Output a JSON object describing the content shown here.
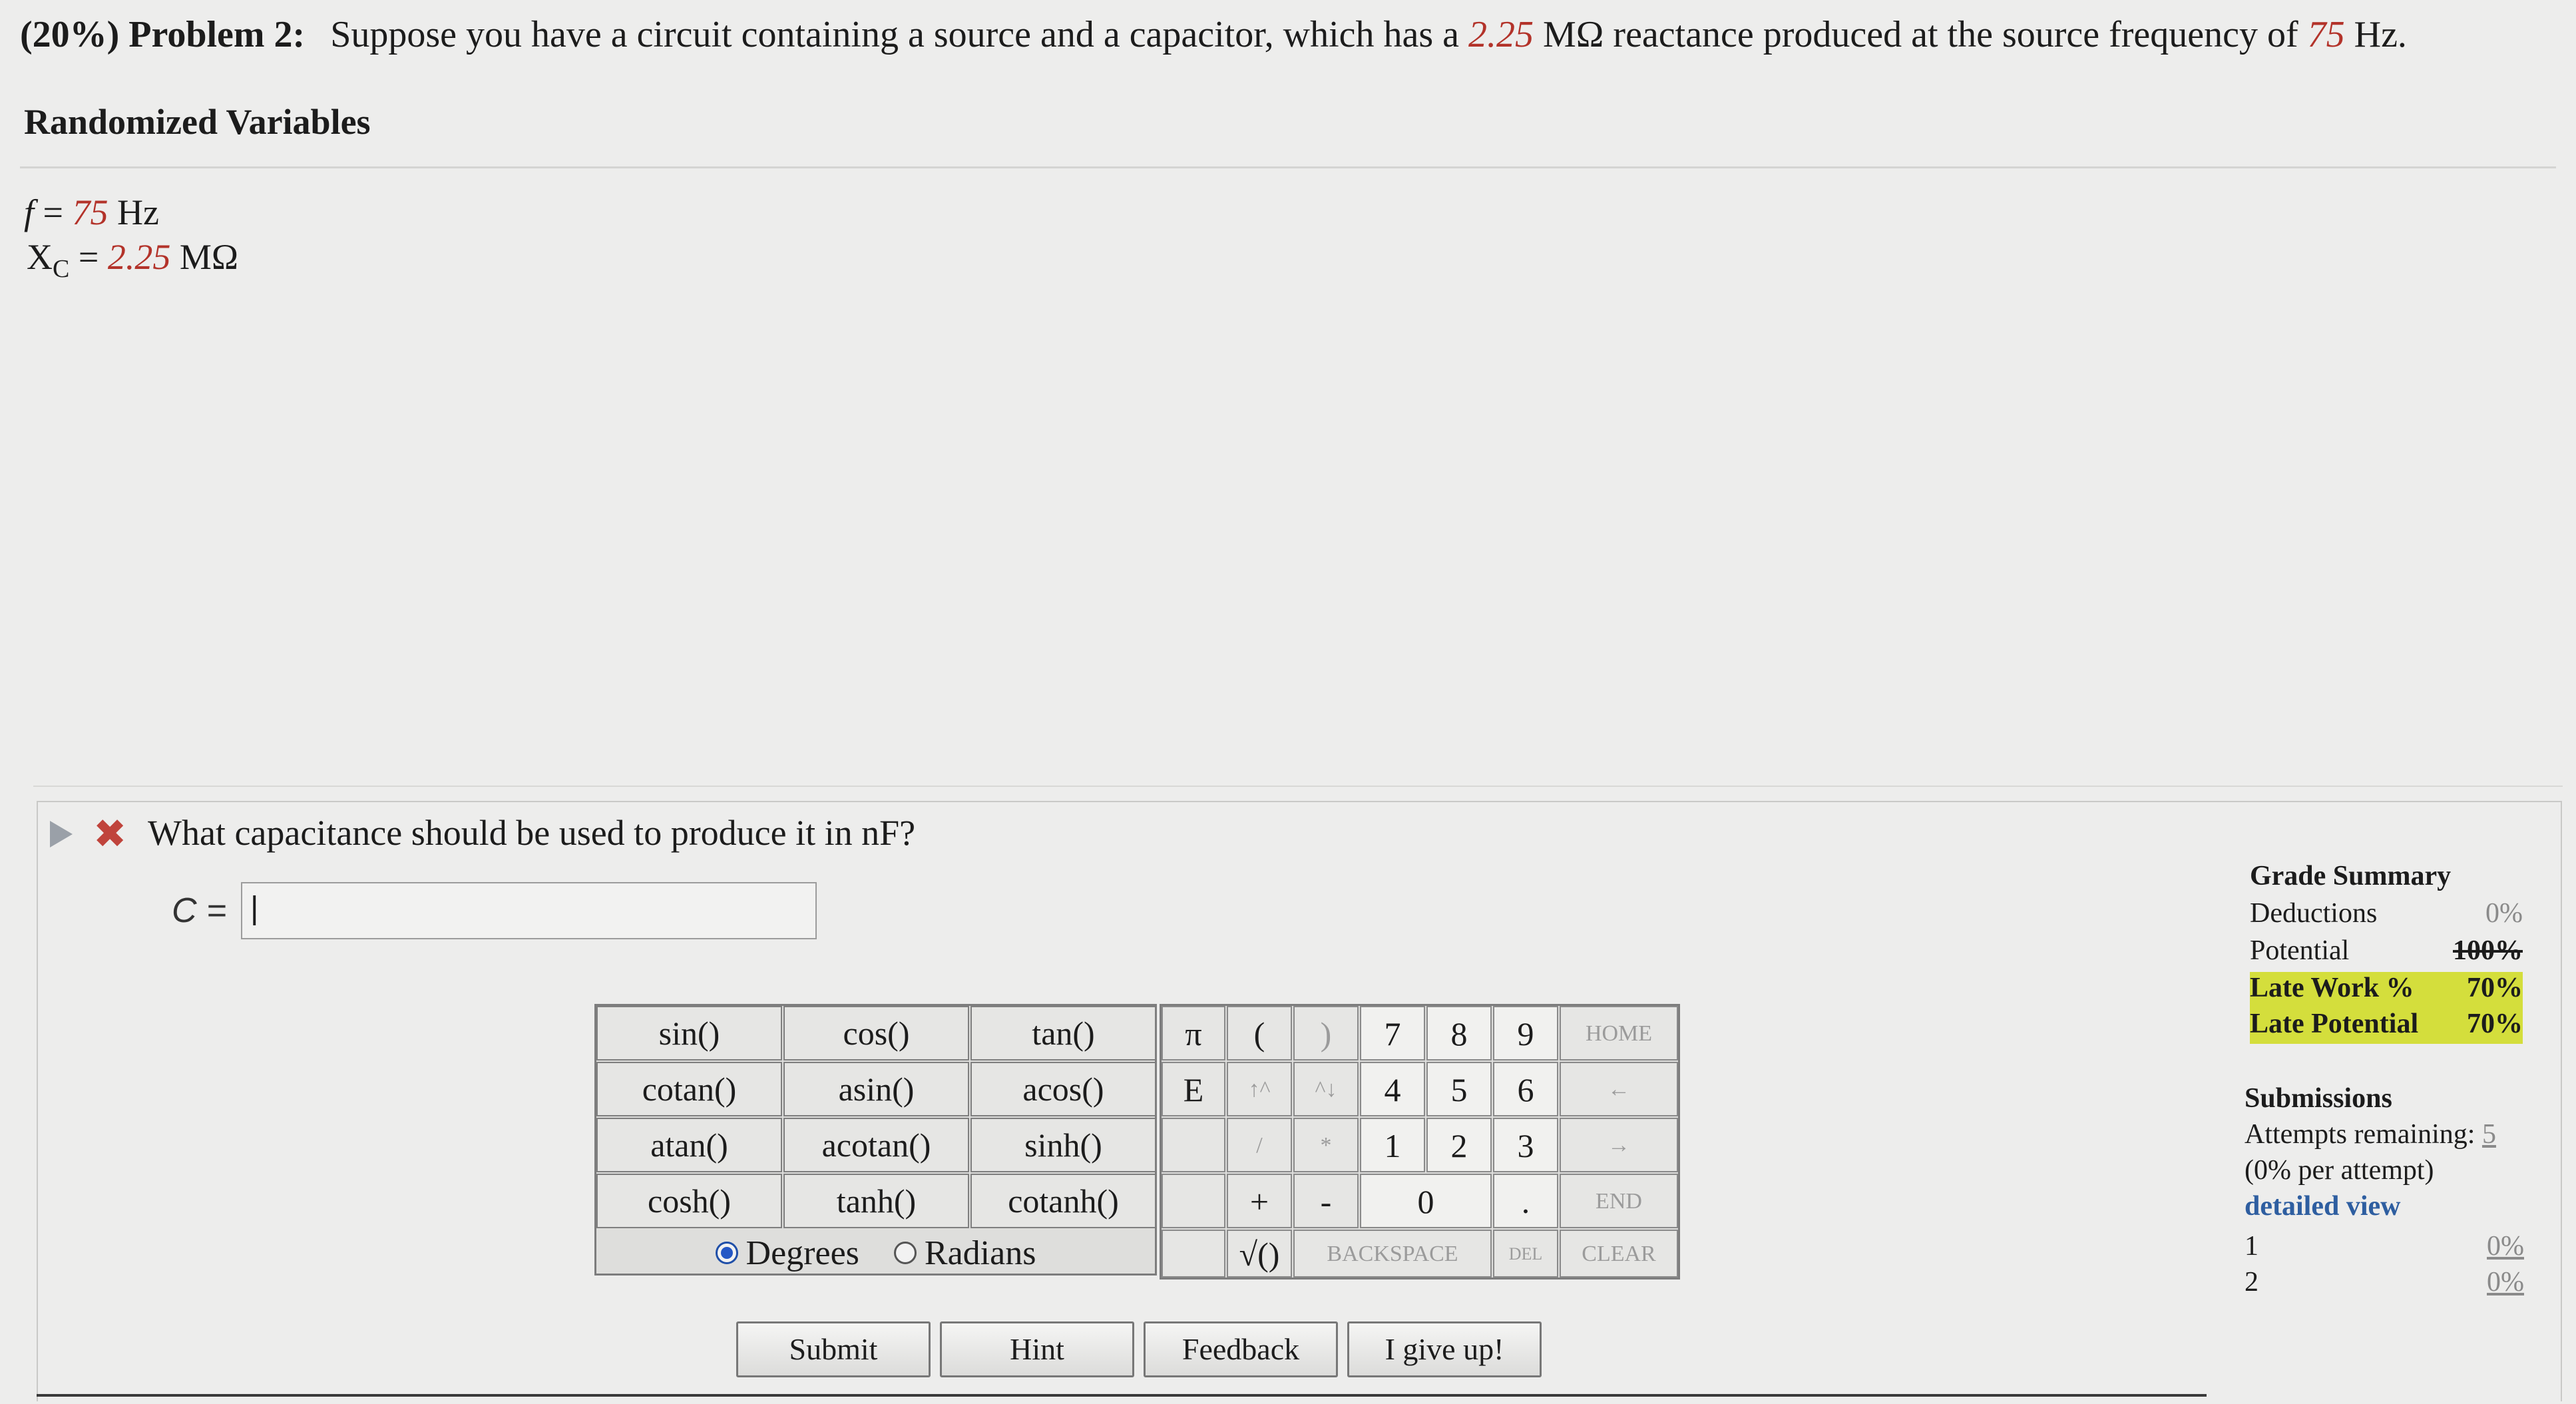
{
  "problem": {
    "percent": "(20%)",
    "title": "Problem 2:",
    "text_before_xc": "Suppose you have a circuit containing a source and a capacitor, which has a",
    "xc_value": "2.25",
    "text_mid": "MΩ reactance produced at the source frequency of",
    "f_value": "75",
    "text_end": "Hz."
  },
  "randomized": {
    "title": "Randomized Variables",
    "f_symbol": "f",
    "f_eq": "=",
    "f_value": "75",
    "f_unit": "Hz",
    "xc_symbol": "X",
    "xc_sub": "C",
    "xc_eq": "=",
    "xc_value": "2.25",
    "xc_unit": "MΩ"
  },
  "question": {
    "text": "What capacitance should be used to produce it in nF?",
    "answer_label": "C =",
    "answer_value": "|"
  },
  "functions": [
    "sin()",
    "cos()",
    "tan()",
    "cotan()",
    "asin()",
    "acos()",
    "atan()",
    "acotan()",
    "sinh()",
    "cosh()",
    "tanh()",
    "cotanh()"
  ],
  "angle_mode": {
    "degrees": "Degrees",
    "radians": "Radians",
    "selected": "Degrees"
  },
  "keypad": {
    "pi": "π",
    "e": "E",
    "lparen": "(",
    "rparen": ")",
    "up": "↑^",
    "down": "^↓",
    "div": "/",
    "mul": "*",
    "plus": "+",
    "minus": "-",
    "sqrt": "√()",
    "dot": ".",
    "digits": [
      "7",
      "8",
      "9",
      "4",
      "5",
      "6",
      "1",
      "2",
      "3",
      "0"
    ],
    "home": "HOME",
    "left": "←",
    "right": "→",
    "end": "END",
    "backspace": "BACKSPACE",
    "del": "DEL",
    "clear": "CLEAR"
  },
  "buttons": {
    "submit": "Submit",
    "hint": "Hint",
    "feedback": "Feedback",
    "give_up": "I give up!"
  },
  "grade_summary": {
    "title": "Grade Summary",
    "deductions_label": "Deductions",
    "deductions_value": "0%",
    "potential_label": "Potential",
    "potential_value": "100%",
    "late_work_label": "Late Work %",
    "late_work_value": "70%",
    "late_potential_label": "Late Potential",
    "late_potential_value": "70%"
  },
  "submissions": {
    "title": "Submissions",
    "attempts_label": "Attempts remaining:",
    "attempts_value": "5",
    "per_attempt": "(0% per attempt)",
    "detailed_view": "detailed view",
    "rows": [
      {
        "n": "1",
        "v": "0%"
      },
      {
        "n": "2",
        "v": "0%"
      }
    ]
  }
}
